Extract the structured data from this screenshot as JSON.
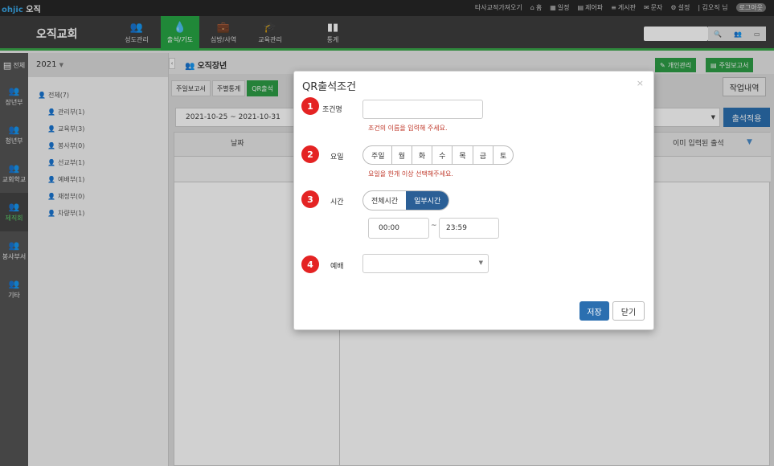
{
  "topbar": {
    "brand_prefix": "ohjic",
    "brand_name": "오직",
    "links": [
      {
        "icon": "",
        "label": "타사교적가져오기"
      },
      {
        "icon": "home-icon",
        "label": "홈"
      },
      {
        "icon": "calendar-icon",
        "label": "일정"
      },
      {
        "icon": "printer-icon",
        "label": "제어파"
      },
      {
        "icon": "board-icon",
        "label": "게시판"
      },
      {
        "icon": "mail-icon",
        "label": "문자"
      },
      {
        "icon": "gear-icon",
        "label": "설정"
      }
    ],
    "user": "| 김오직 님",
    "logout": "로그아웃"
  },
  "navbar": {
    "church": "오직교회",
    "items": [
      {
        "icon": "users-icon",
        "label": "성도관리"
      },
      {
        "icon": "drop-icon",
        "label": "출석/기도"
      },
      {
        "icon": "briefcase-icon",
        "label": "심방/사역"
      },
      {
        "icon": "graduation-icon",
        "label": "교육관리"
      },
      {
        "icon": "chart-icon",
        "label": "통계"
      }
    ],
    "search_placeholder": ""
  },
  "iconbar": {
    "items": [
      {
        "label": "전체"
      },
      {
        "label": "장년부"
      },
      {
        "label": "청년부"
      },
      {
        "label": "교회학교"
      },
      {
        "label": "제직회"
      },
      {
        "label": "봉사부서"
      },
      {
        "label": "기타"
      }
    ]
  },
  "tree": {
    "year": "2021",
    "root": "전체(7)",
    "children": [
      "관리부(1)",
      "교육부(3)",
      "봉사부(0)",
      "선교부(1)",
      "예배부(1)",
      "재정부(0)",
      "차량부(1)"
    ]
  },
  "content": {
    "page_title": "오직장년",
    "btn_personal": "개인관리",
    "btn_weekly": "주일보고서",
    "tabs": [
      "주일보고서",
      "주별통계",
      "QR출석"
    ],
    "work_btn": "작업내역",
    "date_range": "2021-10-25 ~ 2021-10-31",
    "apply_btn": "출석적용",
    "col_date": "날짜",
    "col_already": "이미 입력된 출석"
  },
  "modal": {
    "title": "QR출석조건",
    "close": "×",
    "name_label": "조건명",
    "name_value": "",
    "name_error": "조건의 이름을 입력해 주세요.",
    "day_label": "요일",
    "days": [
      "주일",
      "월",
      "화",
      "수",
      "목",
      "금",
      "토"
    ],
    "day_error": "요일을 한개 이상 선택해주세요.",
    "time_label": "시간",
    "time_opts": [
      "전체시간",
      "일부시간"
    ],
    "time_start": "00:00",
    "time_tilde": "~",
    "time_end": "23:59",
    "worship_label": "예배",
    "worship_value": "",
    "save": "저장",
    "cancel": "닫기",
    "badges": [
      "1",
      "2",
      "3",
      "4"
    ]
  },
  "colors": {
    "green": "#2e9e46",
    "blue": "#2b6fb0",
    "badge_red": "#e42323",
    "error": "#c0392b"
  }
}
